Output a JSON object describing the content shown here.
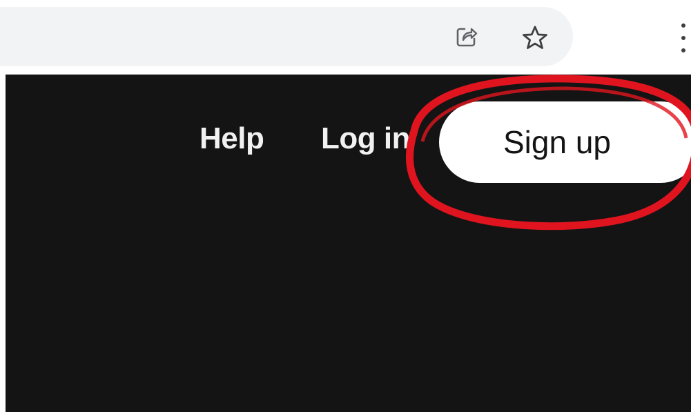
{
  "browser": {
    "share_icon": "share-icon",
    "bookmark_icon": "star-icon",
    "menu_icon": "vertical-dots-icon"
  },
  "nav": {
    "help_label": "Help",
    "login_label": "Log in",
    "signup_label": "Sign up"
  },
  "colors": {
    "page_background": "#141414",
    "signup_button_bg": "#ffffff",
    "annotation_circle": "#e0141e"
  }
}
